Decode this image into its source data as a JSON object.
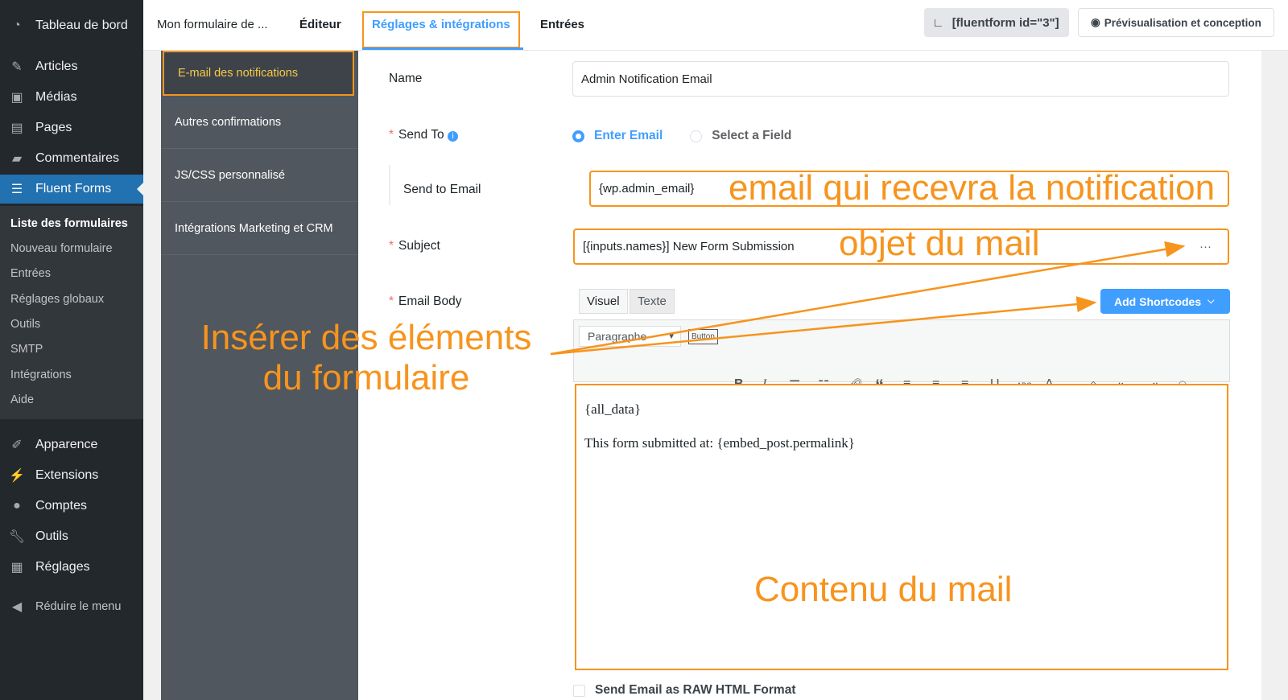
{
  "wp_menu": {
    "items": [
      {
        "label": "Tableau de bord",
        "icon": "dashboard-icon"
      },
      {
        "label": "Articles",
        "icon": "pin-icon"
      },
      {
        "label": "Médias",
        "icon": "media-icon"
      },
      {
        "label": "Pages",
        "icon": "pages-icon"
      },
      {
        "label": "Commentaires",
        "icon": "comments-icon"
      },
      {
        "label": "Fluent Forms",
        "icon": "forms-icon"
      }
    ],
    "submenu": [
      "Liste des formulaires",
      "Nouveau formulaire",
      "Entrées",
      "Réglages globaux",
      "Outils",
      "SMTP",
      "Intégrations",
      "Aide"
    ],
    "items2": [
      {
        "label": "Apparence",
        "icon": "brush-icon"
      },
      {
        "label": "Extensions",
        "icon": "plugin-icon"
      },
      {
        "label": "Comptes",
        "icon": "user-icon"
      },
      {
        "label": "Outils",
        "icon": "wrench-icon"
      },
      {
        "label": "Réglages",
        "icon": "settings-icon"
      }
    ],
    "collapse": "Réduire le menu"
  },
  "topbar": {
    "form_name": "Mon formulaire de ...",
    "tabs": [
      "Éditeur",
      "Réglages & intégrations",
      "Entrées"
    ],
    "shortcode": "[fluentform id=\"3\"]",
    "preview": "Prévisualisation et conception"
  },
  "settings_nav": [
    "E-mail des notifications",
    "Autres confirmations",
    "JS/CSS personnalisé",
    "Intégrations Marketing et CRM"
  ],
  "form": {
    "name_label": "Name",
    "name_value": "Admin Notification Email",
    "send_to_label": "Send To",
    "radio_enter": "Enter Email",
    "radio_field": "Select a Field",
    "send_to_email_label": "Send to Email",
    "send_to_email_value": "{wp.admin_email}",
    "subject_label": "Subject",
    "subject_value": "[{inputs.names}] New Form Submission",
    "subject_more": "···",
    "body_label": "Email Body",
    "editor_tabs": [
      "Visuel",
      "Texte"
    ],
    "add_shortcodes": "Add Shortcodes",
    "format_select": "Paragraphe",
    "button_btn": "Button",
    "body_lines": [
      "{all_data}",
      "This form submitted at: {embed_post.permalink}"
    ],
    "raw_html": "Send Email as RAW HTML Format"
  },
  "annotations": {
    "email": "email qui recevra la notification",
    "subject": "objet du mail",
    "insert1": "Insérer des éléments",
    "insert2": "du formulaire",
    "content": "Contenu du mail"
  },
  "colors": {
    "accent": "#409eff",
    "annotation": "#f7941d",
    "wp_active": "#2271b1"
  }
}
